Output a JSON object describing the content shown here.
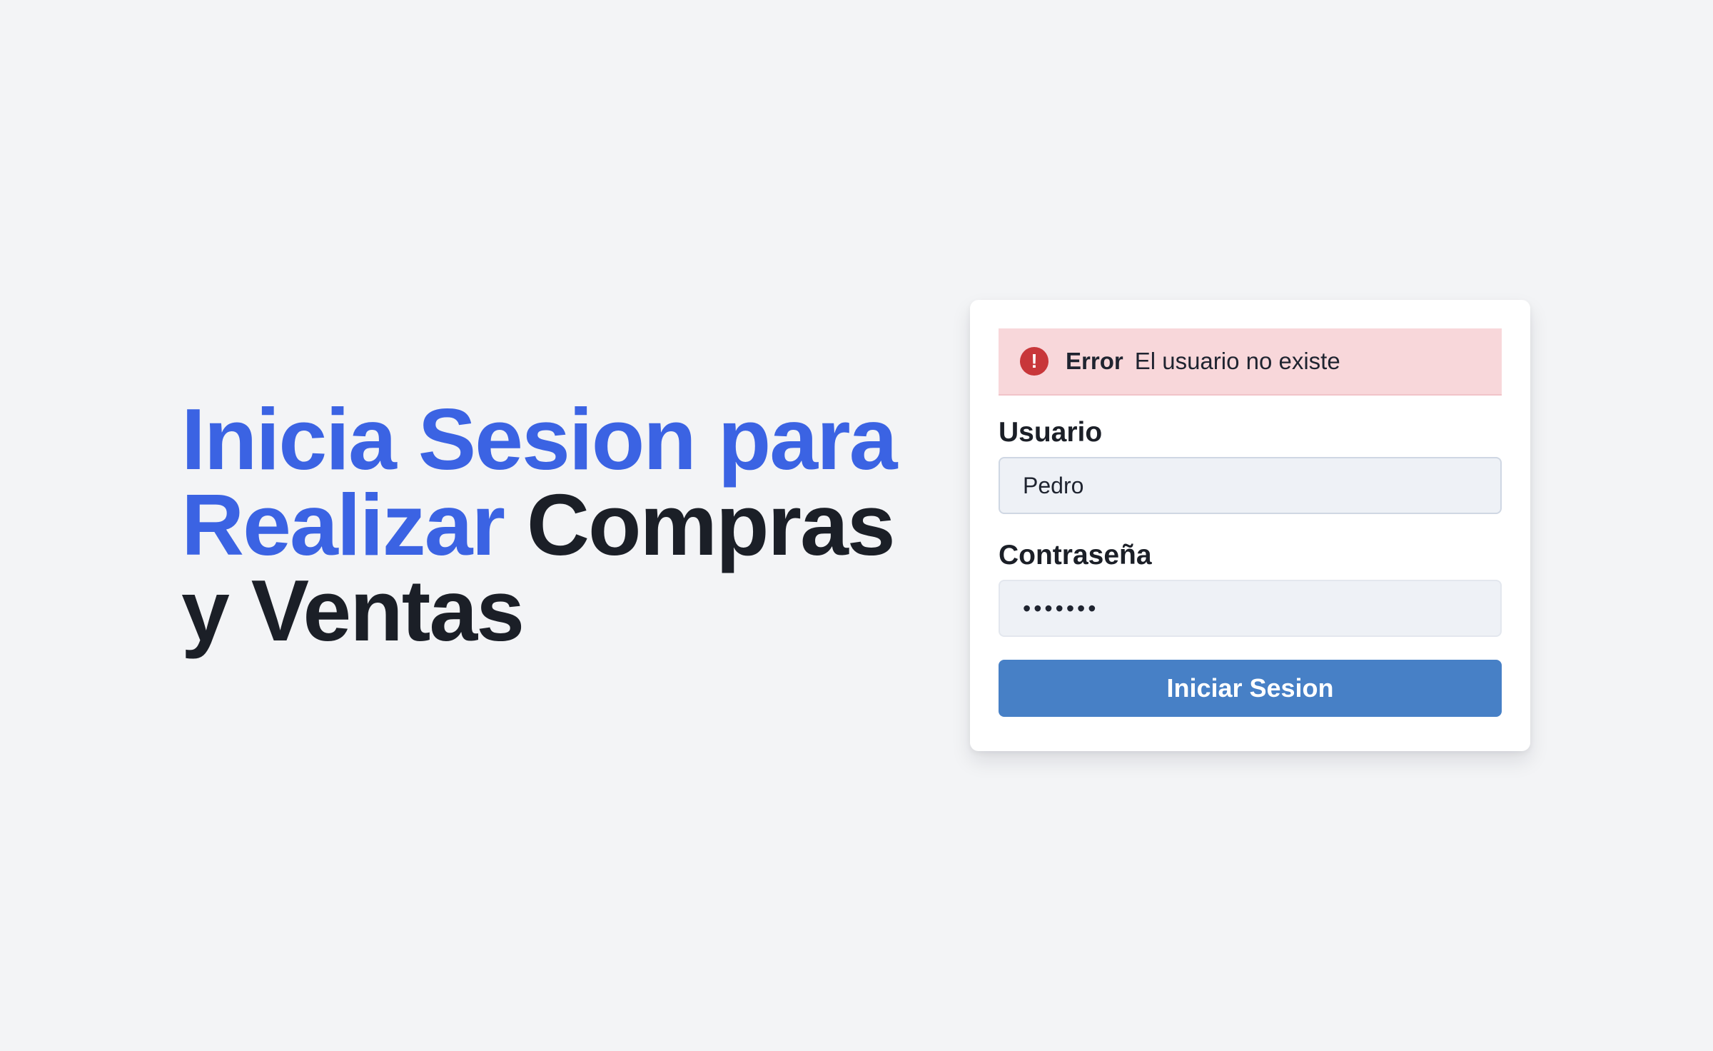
{
  "hero": {
    "line1": "Inicia Sesion para",
    "line2_accent": "Realizar",
    "line2_rest": "Compras",
    "line3": "y Ventas"
  },
  "alert": {
    "icon": "exclamation-icon",
    "icon_glyph": "!",
    "title": "Error",
    "message": "El usuario no existe",
    "background_color": "#f8d7da",
    "icon_color": "#c8373a"
  },
  "form": {
    "username_label": "Usuario",
    "username_value": "Pedro",
    "password_label": "Contraseña",
    "password_value": "•••••••",
    "submit_label": "Iniciar Sesion"
  },
  "colors": {
    "accent": "#3b63e3",
    "heading": "#1b1f27",
    "button": "#4780c6",
    "page_background": "#f3f4f6"
  }
}
